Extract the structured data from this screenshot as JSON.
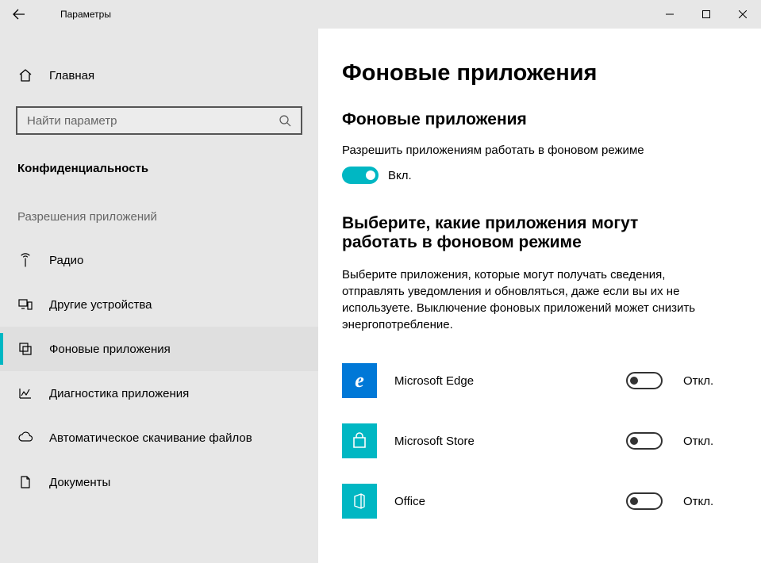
{
  "titlebar": {
    "title": "Параметры"
  },
  "sidebar": {
    "home": "Главная",
    "search_placeholder": "Найти параметр",
    "category": "Конфиденциальность",
    "group": "Разрешения приложений",
    "items": [
      {
        "label": "Радио"
      },
      {
        "label": "Другие устройства"
      },
      {
        "label": "Фоновые приложения"
      },
      {
        "label": "Диагностика приложения"
      },
      {
        "label": "Автоматическое скачивание файлов"
      },
      {
        "label": "Документы"
      }
    ],
    "active_index": 2
  },
  "main": {
    "page_title": "Фоновые приложения",
    "master": {
      "section_title": "Фоновые приложения",
      "label": "Разрешить приложениям работать в фоновом режиме",
      "state": "on",
      "state_text": "Вкл."
    },
    "choose": {
      "section_title": "Выберите, какие приложения могут работать в фоновом режиме",
      "description": "Выберите приложения, которые могут получать сведения, отправлять уведомления и обновляться, даже если вы их не используете. Выключение фоновых приложений может снизить энергопотребление."
    },
    "apps": [
      {
        "name": "Microsoft Edge",
        "state": "off",
        "state_text": "Откл.",
        "icon_bg": "#0078D7",
        "icon_letter": "e"
      },
      {
        "name": "Microsoft Store",
        "state": "off",
        "state_text": "Откл.",
        "icon_bg": "#00B7C3",
        "icon_letter": ""
      },
      {
        "name": "Office",
        "state": "off",
        "state_text": "Откл.",
        "icon_bg": "#00B7C3",
        "icon_letter": ""
      }
    ]
  }
}
